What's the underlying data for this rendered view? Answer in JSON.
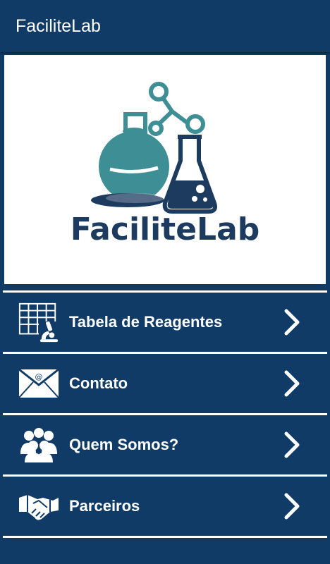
{
  "app": {
    "title": "FaciliteLab"
  },
  "banner": {
    "logo_text": "FaciliteLab"
  },
  "menu": {
    "items": [
      {
        "label": "Tabela de Reagentes",
        "icon": "reagent-table-icon"
      },
      {
        "label": "Contato",
        "icon": "envelope-icon"
      },
      {
        "label": "Quem Somos?",
        "icon": "people-group-icon"
      },
      {
        "label": "Parceiros",
        "icon": "handshake-icon"
      }
    ]
  },
  "colors": {
    "primary": "#0f3b66",
    "teal": "#3e8f95",
    "navy": "#1d3a5f",
    "white": "#ffffff"
  }
}
